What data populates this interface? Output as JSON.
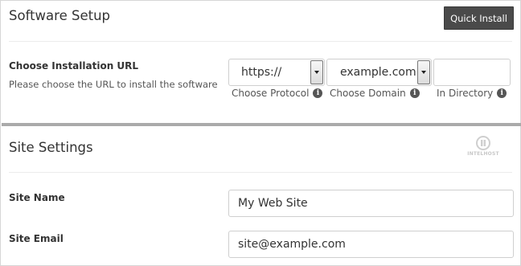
{
  "header": {
    "title": "Software Setup",
    "quick_install_label": "Quick Install"
  },
  "install_url": {
    "label": "Choose Installation URL",
    "description": "Please choose the URL to install the software",
    "protocol": {
      "value": "https://",
      "caption": "Choose Protocol"
    },
    "domain": {
      "value": "example.com",
      "caption": "Choose Domain"
    },
    "directory": {
      "value": "",
      "caption": "In Directory"
    }
  },
  "site_settings": {
    "title": "Site Settings",
    "logo_text": "INTELHOST",
    "site_name": {
      "label": "Site Name",
      "value": "My Web Site"
    },
    "site_email": {
      "label": "Site Email",
      "value": "site@example.com"
    }
  },
  "icons": {
    "info": "info-circle-icon",
    "logo": "intelhost-logo-icon"
  },
  "colors": {
    "button_bg": "#4a4a4a",
    "divider_heavy": "#aaaaaa",
    "text": "#333333"
  }
}
